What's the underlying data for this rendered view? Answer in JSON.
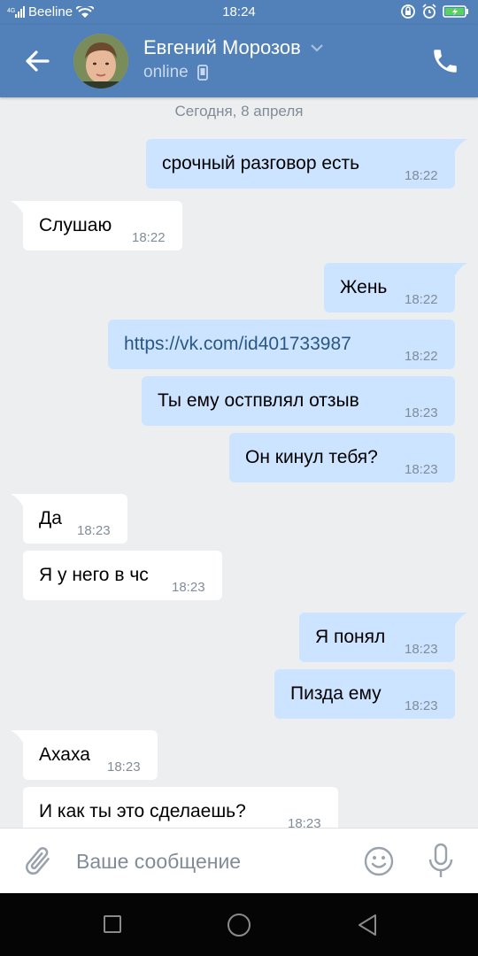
{
  "status_bar": {
    "network": "4G",
    "carrier": "Beeline",
    "time": "18:24"
  },
  "header": {
    "contact_name": "Евгений Морозов",
    "contact_status": "online",
    "icons": [
      "back-arrow-icon",
      "avatar",
      "chevron-down-icon",
      "mobile-phone-icon",
      "phone-call-icon"
    ]
  },
  "date_separator": "Сегодня, 8 апреля",
  "messages": [
    {
      "dir": "out",
      "text": "срочный разговор есть",
      "time": "18:22"
    },
    {
      "dir": "in",
      "text": "Слушаю",
      "time": "18:22"
    },
    {
      "dir": "out",
      "text": "Жень",
      "time": "18:22"
    },
    {
      "dir": "out",
      "text": "https://vk.com/id401733987",
      "time": "18:22",
      "is_link": true
    },
    {
      "dir": "out",
      "text": "Ты ему остпвлял отзыв",
      "time": "18:23"
    },
    {
      "dir": "out",
      "text": "Он кинул тебя?",
      "time": "18:23"
    },
    {
      "dir": "in",
      "text": "Да",
      "time": "18:23"
    },
    {
      "dir": "in",
      "text": "Я у него в чс",
      "time": "18:23"
    },
    {
      "dir": "out",
      "text": "Я понял",
      "time": "18:23"
    },
    {
      "dir": "out",
      "text": "Пизда ему",
      "time": "18:23"
    },
    {
      "dir": "in",
      "text": "Ахаха",
      "time": "18:23"
    },
    {
      "dir": "in",
      "text": "И как ты это сделаешь?",
      "time": "18:23"
    }
  ],
  "composer": {
    "placeholder": "Ваше сообщение",
    "icons": [
      "attach-icon",
      "emoji-icon",
      "microphone-icon"
    ]
  },
  "nav_bar": {
    "icons": [
      "recent-apps-icon",
      "home-icon",
      "back-icon"
    ]
  },
  "colors": {
    "header_bg": "#5181b8",
    "chat_bg": "#edeef0",
    "outgoing_bubble": "#cce4ff",
    "incoming_bubble": "#ffffff",
    "link": "#2a5885",
    "muted_text": "#818c99"
  }
}
